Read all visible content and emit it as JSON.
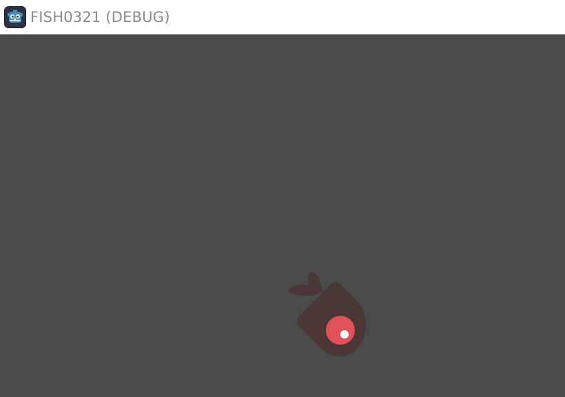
{
  "window": {
    "title": "FISH0321 (DEBUG)",
    "app_icon": "godot-engine-icon"
  },
  "viewport": {
    "background_color": "#4a4a4a"
  },
  "sprites": {
    "fish": {
      "icon": "fish-icon",
      "body_color": "#4b3636",
      "eye_color": "#e0525a",
      "pupil_color": "#ffffff"
    }
  }
}
